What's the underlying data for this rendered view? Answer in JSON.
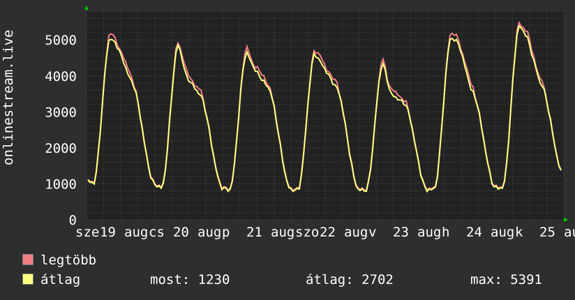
{
  "chart_data": {
    "type": "line",
    "ylabel": "onlinestream.live",
    "ylim": [
      0,
      5800
    ],
    "y_ticks": [
      0,
      1000,
      2000,
      3000,
      4000,
      5000
    ],
    "x_tick_labels": [
      "sze",
      "19",
      "aug",
      "cs",
      "20",
      "aug",
      "p",
      "21",
      "aug",
      "szo",
      "22",
      "aug",
      "v",
      "23",
      "aug",
      "h",
      "24",
      "aug",
      "k",
      "25",
      "aug"
    ],
    "days": [
      {
        "start": 1100,
        "mid": 1000,
        "peak": 5070,
        "plateau": 4800,
        "late": 3850,
        "end": 1000
      },
      {
        "start": 980,
        "mid": 880,
        "peak": 4880,
        "plateau": 4000,
        "late": 3500,
        "end": 880
      },
      {
        "start": 870,
        "mid": 830,
        "peak": 4650,
        "plateau": 4200,
        "late": 3700,
        "end": 830
      },
      {
        "start": 840,
        "mid": 820,
        "peak": 4620,
        "plateau": 4300,
        "late": 3700,
        "end": 820
      },
      {
        "start": 830,
        "mid": 820,
        "peak": 4350,
        "plateau": 3500,
        "late": 3250,
        "end": 820
      },
      {
        "start": 840,
        "mid": 850,
        "peak": 5070,
        "plateau": 4900,
        "late": 3550,
        "end": 880
      },
      {
        "start": 890,
        "mid": 880,
        "peak": 5391,
        "plateau": 5100,
        "late": 3800,
        "end": 1230
      }
    ],
    "series": [
      {
        "name": "legtöbb",
        "color": "#f07f85"
      },
      {
        "name": "átlag",
        "color": "#ffff80"
      }
    ],
    "grid": true
  },
  "legend": {
    "max_label": "legtöbb",
    "avg_label": "átlag",
    "stats": {
      "now_label": "most:",
      "now_value": "1230",
      "avg_label": "átlag:",
      "avg_value": "2702",
      "max_label": "max:",
      "max_value": "5391"
    }
  },
  "colors": {
    "background": "#2e2e2e",
    "plot_background": "#222222",
    "grid": "#4a4a4a",
    "max_series": "#f07f85",
    "avg_series": "#ffff80",
    "axis_arrow": "#00cc00"
  }
}
